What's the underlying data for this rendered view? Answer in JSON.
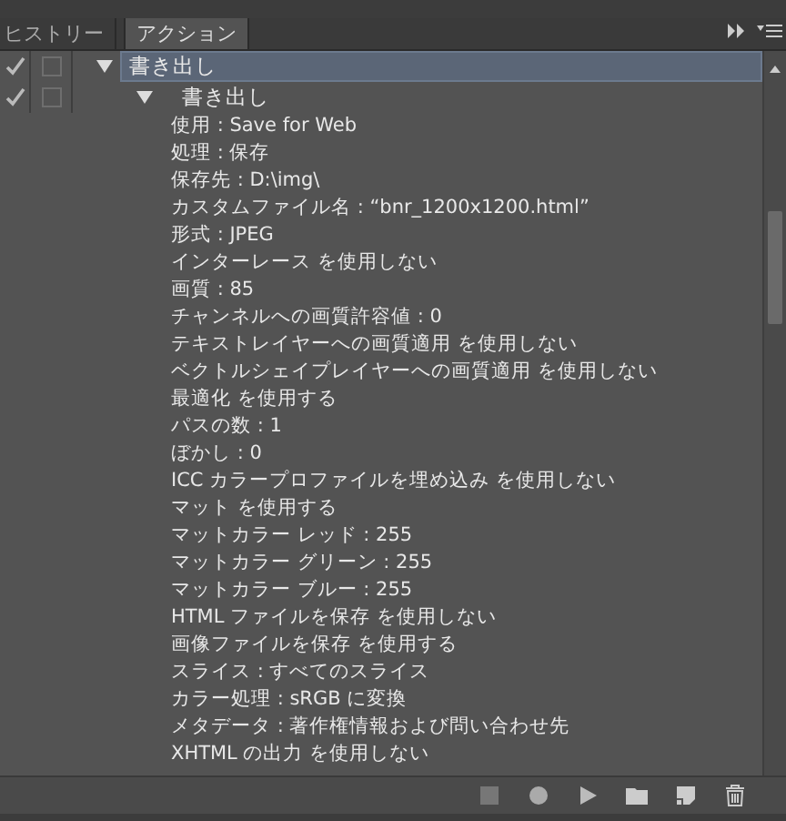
{
  "tabs": [
    {
      "label": "ヒストリー",
      "selected": false
    },
    {
      "label": "アクション",
      "selected": true
    }
  ],
  "tree": [
    {
      "label": "書き出し",
      "enabled": true,
      "dialog": false,
      "selected": true,
      "expanded": true,
      "children": [
        {
          "label": "書き出し",
          "enabled": true,
          "dialog": false,
          "selected": false,
          "expanded": true,
          "details": [
            "使用 : Save for Web",
            "処理 : 保存",
            "保存先 : D:\\img\\",
            "カスタムファイル名 : “bnr_1200x1200.html”",
            "形式 : JPEG",
            "インターレース を使用しない",
            "画質 : 85",
            "チャンネルへの画質許容値 : 0",
            "テキストレイヤーへの画質適用 を使用しない",
            "ベクトルシェイプレイヤーへの画質適用 を使用しない",
            "最適化 を使用する",
            "パスの数 : 1",
            "ぼかし : 0",
            "ICC カラープロファイルを埋め込み を使用しない",
            "マット を使用する",
            "マットカラー レッド : 255",
            "マットカラー グリーン : 255",
            "マットカラー ブルー : 255",
            "HTML ファイルを保存 を使用しない",
            "画像ファイルを保存 を使用する",
            "スライス : すべてのスライス",
            "カラー処理 : sRGB に変換",
            "メタデータ : 著作権情報および問い合わせ先",
            "XHTML の出力 を使用しない"
          ]
        }
      ]
    }
  ]
}
